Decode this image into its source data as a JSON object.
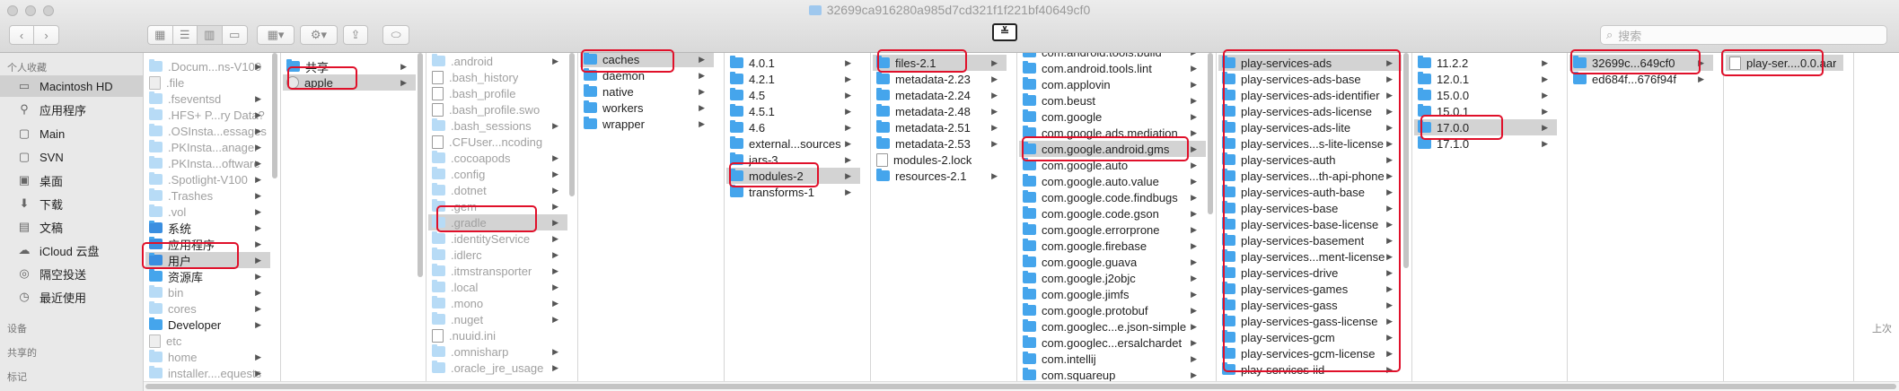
{
  "window": {
    "title": "32699ca916280a985d7cd321f1f221bf40649cf0"
  },
  "toolbar": {
    "search_placeholder": "搜索",
    "title_glyph": "≚"
  },
  "sidebar": {
    "favorites_label": "个人收藏",
    "favorites": [
      {
        "label": "Macintosh HD",
        "icon": "hard-drive-icon",
        "selected": true
      },
      {
        "label": "应用程序",
        "icon": "applications-icon"
      },
      {
        "label": "Main",
        "icon": "folder-icon"
      },
      {
        "label": "SVN",
        "icon": "folder-icon"
      },
      {
        "label": "桌面",
        "icon": "desktop-icon"
      },
      {
        "label": "下载",
        "icon": "downloads-icon"
      },
      {
        "label": "文稿",
        "icon": "documents-icon"
      },
      {
        "label": "iCloud 云盘",
        "icon": "cloud-icon"
      },
      {
        "label": "隔空投送",
        "icon": "airdrop-icon"
      },
      {
        "label": "最近使用",
        "icon": "recents-icon"
      }
    ],
    "devices_label": "设备",
    "shared_label": "共享的",
    "tags_label": "标记"
  },
  "columns": [
    {
      "name": "root",
      "items": [
        {
          "label": ".Docum...ns-V100",
          "faded": true,
          "arrow": true
        },
        {
          "label": ".file",
          "faded": true,
          "kind": "ffile"
        },
        {
          "label": ".fseventsd",
          "faded": true,
          "arrow": true
        },
        {
          "label": ".HFS+ P...ry Data?",
          "faded": true,
          "arrow": true
        },
        {
          "label": ".OSInsta...essages",
          "faded": true,
          "arrow": true
        },
        {
          "label": ".PKInsta...anager",
          "faded": true,
          "arrow": true
        },
        {
          "label": ".PKInsta...oftware",
          "faded": true,
          "arrow": true
        },
        {
          "label": ".Spotlight-V100",
          "faded": true,
          "arrow": true
        },
        {
          "label": ".Trashes",
          "faded": true,
          "arrow": true
        },
        {
          "label": ".vol",
          "faded": true,
          "arrow": true
        },
        {
          "label": "系统",
          "arrow": true,
          "kind": "special"
        },
        {
          "label": "应用程序",
          "arrow": true,
          "kind": "special"
        },
        {
          "label": "用户",
          "arrow": true,
          "selected": true,
          "kind": "special"
        },
        {
          "label": "资源库",
          "arrow": true
        },
        {
          "label": "bin",
          "faded": true,
          "arrow": true
        },
        {
          "label": "cores",
          "faded": true,
          "arrow": true
        },
        {
          "label": "Developer",
          "arrow": true
        },
        {
          "label": "etc",
          "faded": true,
          "kind": "ffile"
        },
        {
          "label": "home",
          "faded": true,
          "arrow": true
        },
        {
          "label": "installer....equests",
          "faded": true,
          "arrow": true
        }
      ]
    },
    {
      "name": "users",
      "items": [
        {
          "label": "共享",
          "arrow": true
        },
        {
          "label": "apple",
          "arrow": true,
          "selected": true,
          "kind": "app"
        }
      ]
    },
    {
      "name": "apple",
      "items": [
        {
          "label": ".android",
          "faded": true,
          "arrow": true
        },
        {
          "label": ".bash_history",
          "faded": true,
          "kind": "file"
        },
        {
          "label": ".bash_profile",
          "faded": true,
          "kind": "file"
        },
        {
          "label": ".bash_profile.swo",
          "faded": true,
          "kind": "file"
        },
        {
          "label": ".bash_sessions",
          "faded": true,
          "arrow": true
        },
        {
          "label": ".CFUser...ncoding",
          "faded": true,
          "kind": "file"
        },
        {
          "label": ".cocoapods",
          "faded": true,
          "arrow": true
        },
        {
          "label": ".config",
          "faded": true,
          "arrow": true
        },
        {
          "label": ".dotnet",
          "faded": true,
          "arrow": true
        },
        {
          "label": ".gem",
          "faded": true,
          "arrow": true
        },
        {
          "label": ".gradle",
          "faded": true,
          "arrow": true,
          "selected": true
        },
        {
          "label": ".identityService",
          "faded": true,
          "arrow": true
        },
        {
          "label": ".idlerc",
          "faded": true,
          "arrow": true
        },
        {
          "label": ".itmstransporter",
          "faded": true,
          "arrow": true
        },
        {
          "label": ".local",
          "faded": true,
          "arrow": true
        },
        {
          "label": ".mono",
          "faded": true,
          "arrow": true
        },
        {
          "label": ".nuget",
          "faded": true,
          "arrow": true
        },
        {
          "label": ".nuuid.ini",
          "faded": true,
          "kind": "file"
        },
        {
          "label": ".omnisharp",
          "faded": true,
          "arrow": true
        },
        {
          "label": ".oracle_jre_usage",
          "faded": true,
          "arrow": true
        }
      ]
    },
    {
      "name": "gradle",
      "items": [
        {
          "label": "caches",
          "arrow": true,
          "selected": true
        },
        {
          "label": "daemon",
          "arrow": true
        },
        {
          "label": "native",
          "arrow": true
        },
        {
          "label": "workers",
          "arrow": true
        },
        {
          "label": "wrapper",
          "arrow": true
        }
      ]
    },
    {
      "name": "caches",
      "items": [
        {
          "label": "4.0.1",
          "arrow": true
        },
        {
          "label": "4.2.1",
          "arrow": true
        },
        {
          "label": "4.5",
          "arrow": true
        },
        {
          "label": "4.5.1",
          "arrow": true
        },
        {
          "label": "4.6",
          "arrow": true
        },
        {
          "label": "external...sources",
          "arrow": true
        },
        {
          "label": "jars-3",
          "arrow": true
        },
        {
          "label": "modules-2",
          "arrow": true,
          "selected": true
        },
        {
          "label": "transforms-1",
          "arrow": true
        }
      ]
    },
    {
      "name": "modules-2",
      "items": [
        {
          "label": "files-2.1",
          "arrow": true,
          "selected": true
        },
        {
          "label": "metadata-2.23",
          "arrow": true
        },
        {
          "label": "metadata-2.24",
          "arrow": true
        },
        {
          "label": "metadata-2.48",
          "arrow": true
        },
        {
          "label": "metadata-2.51",
          "arrow": true
        },
        {
          "label": "metadata-2.53",
          "arrow": true
        },
        {
          "label": "modules-2.lock",
          "kind": "file"
        },
        {
          "label": "resources-2.1",
          "arrow": true
        }
      ]
    },
    {
      "name": "files-2.1",
      "items": [
        {
          "label": "com.android.tools.build",
          "arrow": true
        },
        {
          "label": "com.android.tools.lint",
          "arrow": true
        },
        {
          "label": "com.applovin",
          "arrow": true
        },
        {
          "label": "com.beust",
          "arrow": true
        },
        {
          "label": "com.google",
          "arrow": true
        },
        {
          "label": "com.google.ads.mediation",
          "arrow": true
        },
        {
          "label": "com.google.android.gms",
          "arrow": true,
          "selected": true
        },
        {
          "label": "com.google.auto",
          "arrow": true
        },
        {
          "label": "com.google.auto.value",
          "arrow": true
        },
        {
          "label": "com.google.code.findbugs",
          "arrow": true
        },
        {
          "label": "com.google.code.gson",
          "arrow": true
        },
        {
          "label": "com.google.errorprone",
          "arrow": true
        },
        {
          "label": "com.google.firebase",
          "arrow": true
        },
        {
          "label": "com.google.guava",
          "arrow": true
        },
        {
          "label": "com.google.j2objc",
          "arrow": true
        },
        {
          "label": "com.google.jimfs",
          "arrow": true
        },
        {
          "label": "com.google.protobuf",
          "arrow": true
        },
        {
          "label": "com.googlec...e.json-simple",
          "arrow": true
        },
        {
          "label": "com.googlec...ersalchardet",
          "arrow": true
        },
        {
          "label": "com.intellij",
          "arrow": true
        },
        {
          "label": "com.squareup",
          "arrow": true
        }
      ]
    },
    {
      "name": "gms",
      "items": [
        {
          "label": "play-services-ads",
          "arrow": true,
          "selected": true
        },
        {
          "label": "play-services-ads-base",
          "arrow": true
        },
        {
          "label": "play-services-ads-identifier",
          "arrow": true
        },
        {
          "label": "play-services-ads-license",
          "arrow": true
        },
        {
          "label": "play-services-ads-lite",
          "arrow": true
        },
        {
          "label": "play-services...s-lite-license",
          "arrow": true
        },
        {
          "label": "play-services-auth",
          "arrow": true
        },
        {
          "label": "play-services...th-api-phone",
          "arrow": true
        },
        {
          "label": "play-services-auth-base",
          "arrow": true
        },
        {
          "label": "play-services-base",
          "arrow": true
        },
        {
          "label": "play-services-base-license",
          "arrow": true
        },
        {
          "label": "play-services-basement",
          "arrow": true
        },
        {
          "label": "play-services...ment-license",
          "arrow": true
        },
        {
          "label": "play-services-drive",
          "arrow": true
        },
        {
          "label": "play-services-games",
          "arrow": true
        },
        {
          "label": "play-services-gass",
          "arrow": true
        },
        {
          "label": "play-services-gass-license",
          "arrow": true
        },
        {
          "label": "play-services-gcm",
          "arrow": true
        },
        {
          "label": "play-services-gcm-license",
          "arrow": true
        },
        {
          "label": "play-services-iid",
          "arrow": true
        }
      ]
    },
    {
      "name": "versions",
      "items": [
        {
          "label": "11.2.2",
          "arrow": true
        },
        {
          "label": "12.0.1",
          "arrow": true
        },
        {
          "label": "15.0.0",
          "arrow": true
        },
        {
          "label": "15.0.1",
          "arrow": true
        },
        {
          "label": "17.0.0",
          "arrow": true,
          "selected": true
        },
        {
          "label": "17.1.0",
          "arrow": true
        }
      ]
    },
    {
      "name": "hashes",
      "items": [
        {
          "label": "32699c...649cf0",
          "arrow": true,
          "selected": true
        },
        {
          "label": "ed684f...676f94f",
          "arrow": true
        }
      ]
    },
    {
      "name": "aar",
      "items": [
        {
          "label": "play-ser....0.0.aar",
          "kind": "file",
          "selected": true
        }
      ]
    }
  ],
  "preview": {
    "modified_label": "上次"
  }
}
